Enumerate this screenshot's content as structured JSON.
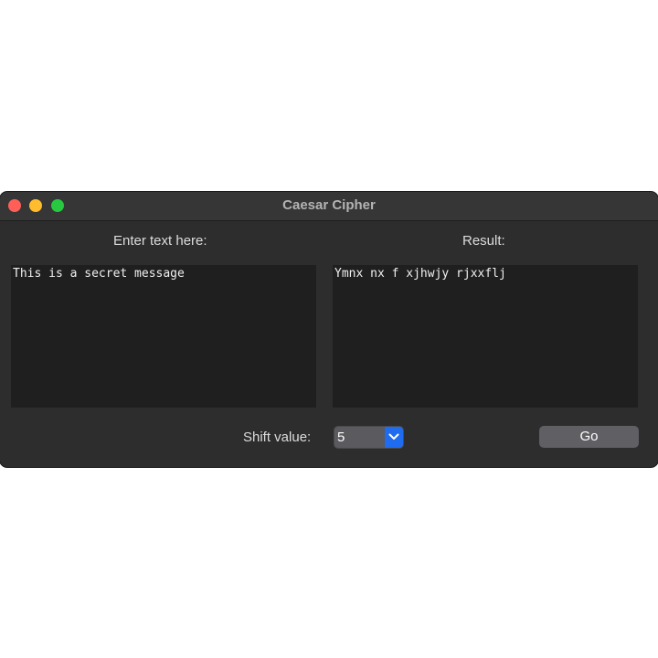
{
  "window": {
    "title": "Caesar Cipher"
  },
  "input_panel": {
    "label": "Enter text here:",
    "value": "This is a secret message"
  },
  "result_panel": {
    "label": "Result:",
    "value": "Ymnx nx f xjhwjy rjxxflj"
  },
  "controls": {
    "shift_label": "Shift value:",
    "shift_value": "5",
    "go_label": "Go"
  },
  "icons": {
    "select_arrow": "chevron-down-icon"
  },
  "colors": {
    "accent": "#1f6cf0",
    "window_bg": "#2d2d2d",
    "text_area_bg": "#1f1f1f"
  }
}
